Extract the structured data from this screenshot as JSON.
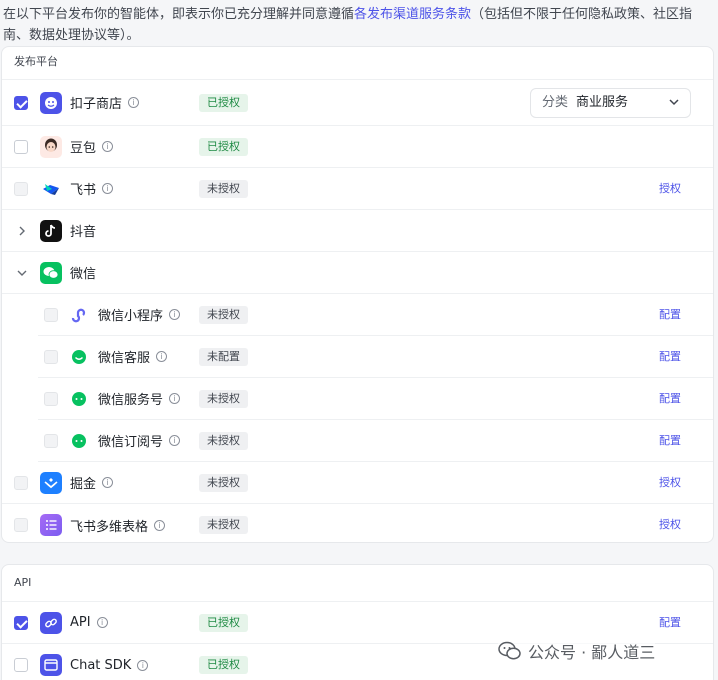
{
  "notice": {
    "text_before": "在以下平台发布你的智能体，即表示你已充分理解并同意遵循",
    "link": "各发布渠道服务条款",
    "text_after": "（包括但不限于任何隐私政策、社区指南、数据处理协议等）。"
  },
  "platforms": {
    "section_title": "发布平台",
    "coze_store": {
      "name": "扣子商店",
      "status": "已授权",
      "category_label": "分类",
      "category_value": "商业服务"
    },
    "doubao": {
      "name": "豆包",
      "status": "已授权"
    },
    "feishu": {
      "name": "飞书",
      "status": "未授权",
      "action": "授权"
    },
    "douyin": {
      "name": "抖音"
    },
    "wechat": {
      "name": "微信"
    },
    "wechat_miniprogram": {
      "name": "微信小程序",
      "status": "未授权",
      "action": "配置"
    },
    "wechat_service": {
      "name": "微信客服",
      "status": "未配置",
      "action": "配置"
    },
    "wechat_official_service": {
      "name": "微信服务号",
      "status": "未授权",
      "action": "配置"
    },
    "wechat_subscription": {
      "name": "微信订阅号",
      "status": "未授权",
      "action": "配置"
    },
    "juejin": {
      "name": "掘金",
      "status": "未授权",
      "action": "授权"
    },
    "feishu_base": {
      "name": "飞书多维表格",
      "status": "未授权",
      "action": "授权"
    }
  },
  "api_section": {
    "section_title": "API",
    "api": {
      "name": "API",
      "status": "已授权",
      "action": "配置"
    },
    "chat_sdk": {
      "name": "Chat SDK",
      "status": "已授权"
    }
  },
  "watermark": {
    "text": "公众号 · 鄙人道三"
  },
  "colors": {
    "accent": "#4d53e8",
    "ok_bg": "#e6f4ea",
    "ok_text": "#1f8a44"
  }
}
